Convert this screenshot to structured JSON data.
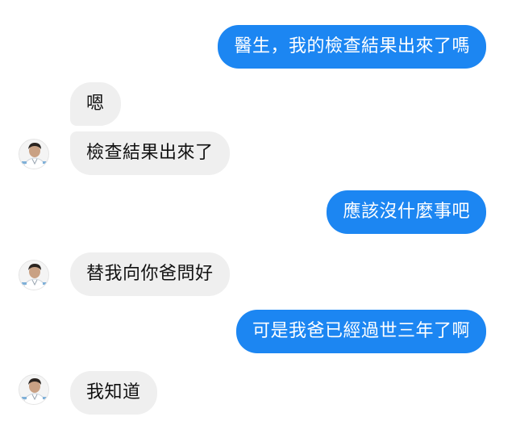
{
  "conversation": {
    "messages": [
      {
        "sender": "me",
        "text": "醫生，我的檢查結果出來了嗎"
      },
      {
        "sender": "doctor",
        "text": "嗯"
      },
      {
        "sender": "doctor",
        "text": "檢查結果出來了"
      },
      {
        "sender": "me",
        "text": "應該沒什麼事吧"
      },
      {
        "sender": "doctor",
        "text": "替我向你爸問好"
      },
      {
        "sender": "me",
        "text": "可是我爸已經過世三年了啊"
      },
      {
        "sender": "doctor",
        "text": "我知道"
      }
    ]
  },
  "colors": {
    "sent_bubble": "#1c86f2",
    "received_bubble": "#efefef",
    "background": "#ffffff"
  },
  "icons": {
    "avatar": "doctor-avatar"
  }
}
